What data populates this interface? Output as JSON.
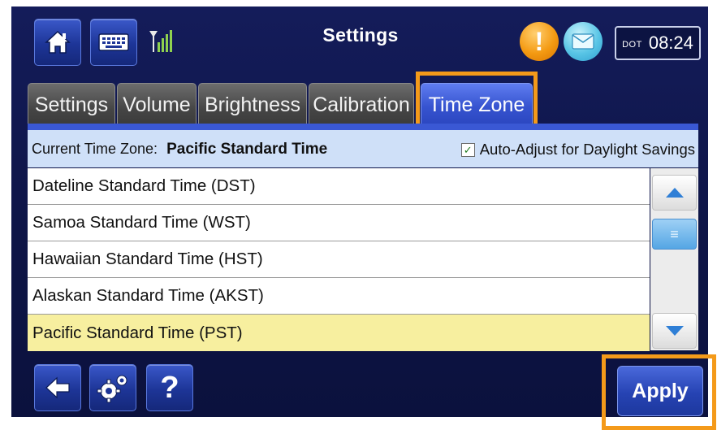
{
  "header": {
    "title": "Settings",
    "clock_zone": "DOT",
    "clock_time": "08:24",
    "icons": [
      "home-icon",
      "keyboard-icon",
      "signal-icon",
      "alert-icon",
      "mail-icon"
    ]
  },
  "tabs": [
    {
      "label": "Settings",
      "active": false
    },
    {
      "label": "Volume",
      "active": false
    },
    {
      "label": "Brightness",
      "active": false
    },
    {
      "label": "Calibration",
      "active": false
    },
    {
      "label": "Time Zone",
      "active": true
    }
  ],
  "timezone": {
    "current_label": "Current Time Zone:",
    "current_value": "Pacific Standard Time",
    "auto_adjust_label": "Auto-Adjust for Daylight Savings",
    "auto_adjust_checked": true,
    "items": [
      {
        "label": "Dateline Standard Time (DST)",
        "selected": false
      },
      {
        "label": "Samoa Standard Time (WST)",
        "selected": false
      },
      {
        "label": "Hawaiian Standard Time (HST)",
        "selected": false
      },
      {
        "label": "Alaskan Standard Time (AKST)",
        "selected": false
      },
      {
        "label": "Pacific Standard Time (PST)",
        "selected": true
      }
    ]
  },
  "footer": {
    "help_label": "?",
    "apply_label": "Apply",
    "icons": [
      "back-arrow-icon",
      "gears-icon",
      "help-icon"
    ]
  },
  "colors": {
    "highlight_outline": "#f49a1a",
    "selected_row": "#f7ef9f",
    "active_tab": "#3653cf"
  }
}
